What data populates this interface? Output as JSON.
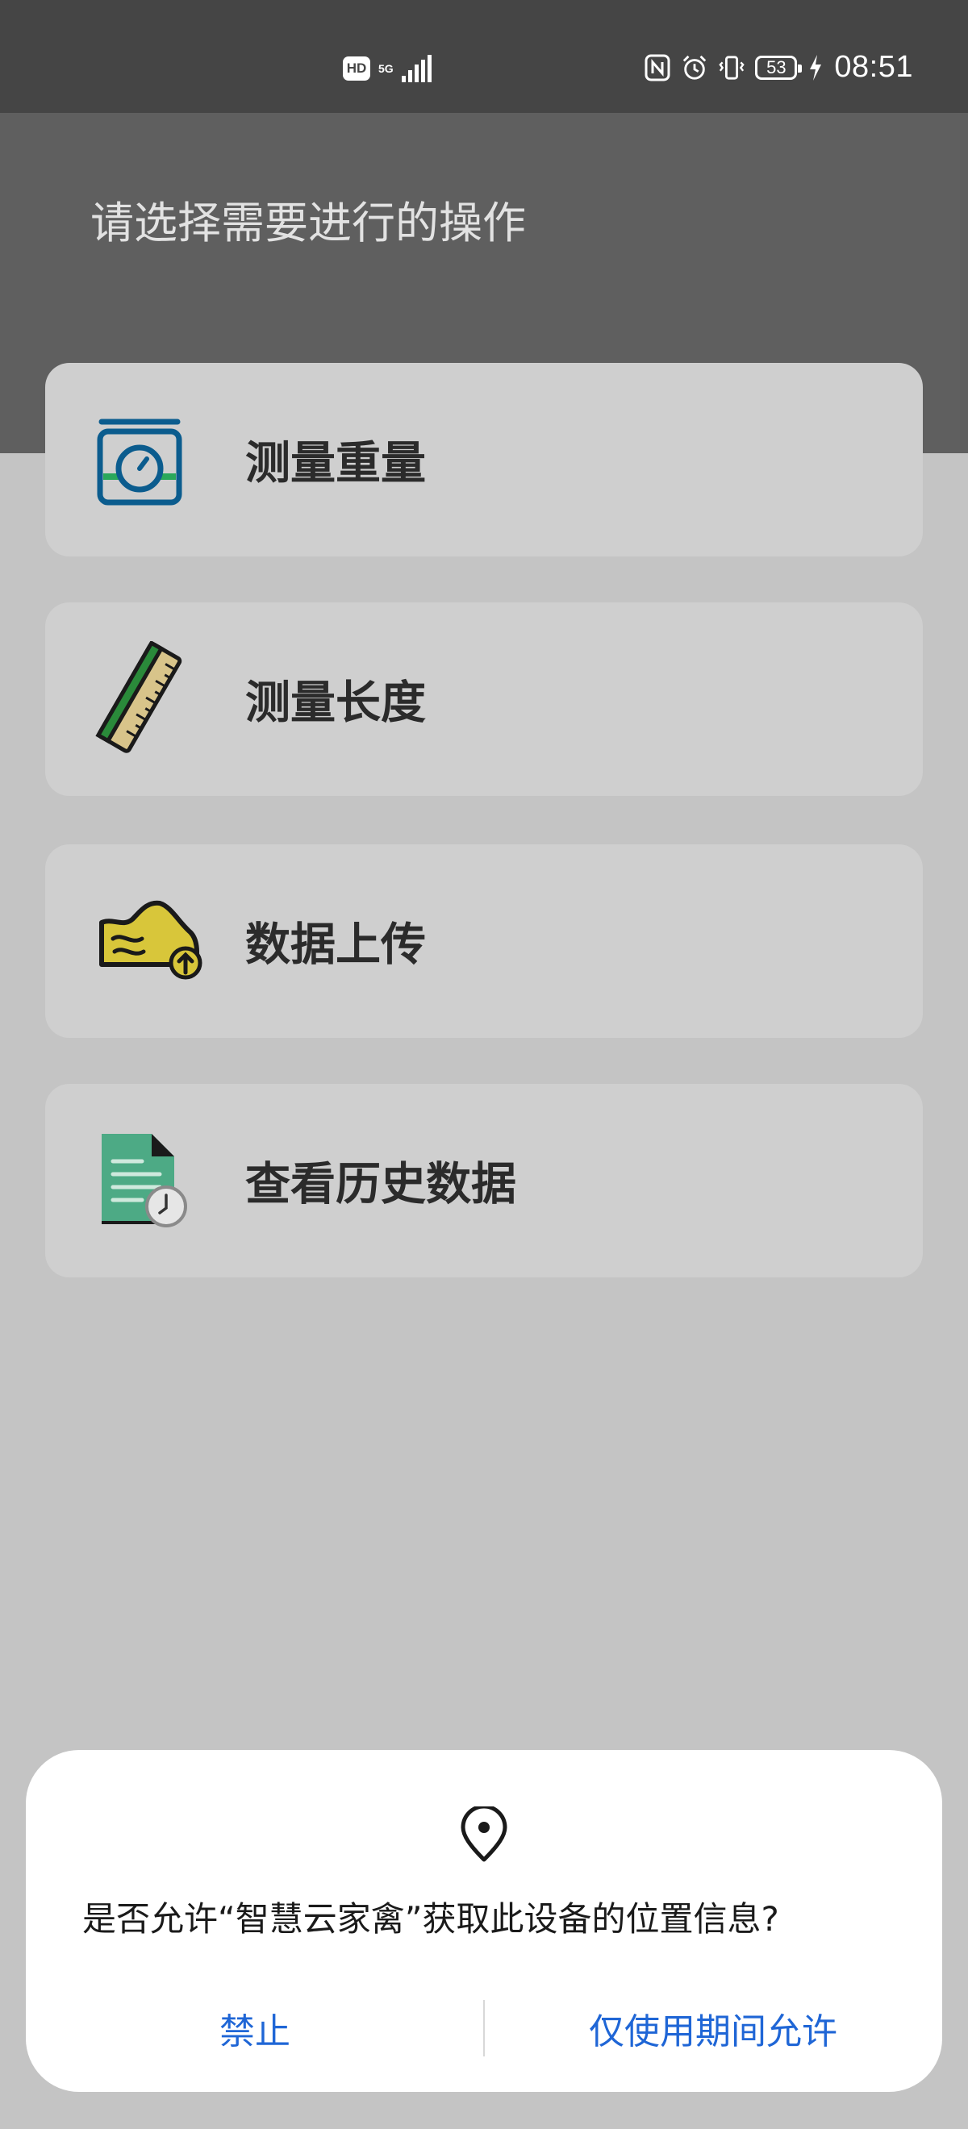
{
  "status_bar": {
    "hd": "HD",
    "network": "5G",
    "battery": "53",
    "time": "08:51"
  },
  "page": {
    "title": "请选择需要进行的操作"
  },
  "menu": [
    {
      "label": "测量重量",
      "icon": "weighing-scale-icon"
    },
    {
      "label": "测量长度",
      "icon": "ruler-icon"
    },
    {
      "label": "数据上传",
      "icon": "data-upload-icon"
    },
    {
      "label": "查看历史数据",
      "icon": "history-document-icon"
    }
  ],
  "dialog": {
    "icon": "location-pin-icon",
    "message": "是否允许“智慧云家禽”获取此设备的位置信息?",
    "deny_label": "禁止",
    "allow_label": "仅使用期间允许"
  },
  "colors": {
    "accent": "#1f66d6",
    "status_bar": "#454545",
    "header": "#5f5f5f",
    "card": "#cfcfcf",
    "background": "#c4c4c4"
  }
}
